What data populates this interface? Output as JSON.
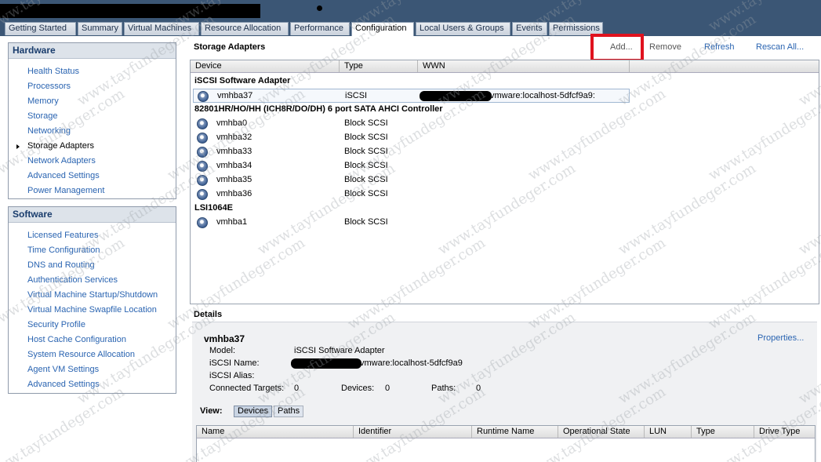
{
  "tabs": [
    {
      "label": "Getting Started"
    },
    {
      "label": "Summary"
    },
    {
      "label": "Virtual Machines"
    },
    {
      "label": "Resource Allocation"
    },
    {
      "label": "Performance"
    },
    {
      "label": "Configuration"
    },
    {
      "label": "Local Users & Groups"
    },
    {
      "label": "Events"
    },
    {
      "label": "Permissions"
    }
  ],
  "hardware": {
    "title": "Hardware",
    "items": [
      {
        "label": "Health Status"
      },
      {
        "label": "Processors"
      },
      {
        "label": "Memory"
      },
      {
        "label": "Storage"
      },
      {
        "label": "Networking"
      },
      {
        "label": "Storage Adapters"
      },
      {
        "label": "Network Adapters"
      },
      {
        "label": "Advanced Settings"
      },
      {
        "label": "Power Management"
      }
    ]
  },
  "software": {
    "title": "Software",
    "items": [
      {
        "label": "Licensed Features"
      },
      {
        "label": "Time Configuration"
      },
      {
        "label": "DNS and Routing"
      },
      {
        "label": "Authentication Services"
      },
      {
        "label": "Virtual Machine Startup/Shutdown"
      },
      {
        "label": "Virtual Machine Swapfile Location"
      },
      {
        "label": "Security Profile"
      },
      {
        "label": "Host Cache Configuration"
      },
      {
        "label": "System Resource Allocation"
      },
      {
        "label": "Agent VM Settings"
      },
      {
        "label": "Advanced Settings"
      }
    ]
  },
  "storage_adapters": {
    "title": "Storage Adapters",
    "actions": {
      "add": "Add...",
      "remove": "Remove",
      "refresh": "Refresh",
      "rescan": "Rescan All..."
    },
    "columns": {
      "device": "Device",
      "type": "Type",
      "wwn": "WWN"
    },
    "groups": [
      {
        "name": "iSCSI Software Adapter",
        "rows": [
          {
            "device": "vmhba37",
            "type": "iSCSI",
            "wwn": "vmware:localhost-5dfcf9a9:"
          }
        ]
      },
      {
        "name": "82801HR/HO/HH (ICH8R/DO/DH) 6 port SATA AHCI Controller",
        "rows": [
          {
            "device": "vmhba0",
            "type": "Block SCSI"
          },
          {
            "device": "vmhba32",
            "type": "Block SCSI"
          },
          {
            "device": "vmhba33",
            "type": "Block SCSI"
          },
          {
            "device": "vmhba34",
            "type": "Block SCSI"
          },
          {
            "device": "vmhba35",
            "type": "Block SCSI"
          },
          {
            "device": "vmhba36",
            "type": "Block SCSI"
          }
        ]
      },
      {
        "name": "LSI1064E",
        "rows": [
          {
            "device": "vmhba1",
            "type": "Block SCSI"
          }
        ]
      }
    ]
  },
  "details": {
    "title": "Details",
    "adapter": "vmhba37",
    "properties_link": "Properties...",
    "model_label": "Model:",
    "model_value": "iSCSI Software Adapter",
    "name_label": "iSCSI Name:",
    "name_value": "vmware:localhost-5dfcf9a9",
    "alias_label": "iSCSI Alias:",
    "targets_label": "Connected Targets:",
    "targets_value": "0",
    "devices_label": "Devices:",
    "devices_value": "0",
    "paths_label": "Paths:",
    "paths_value": "0",
    "view_label": "View:",
    "view_devices": "Devices",
    "view_paths": "Paths",
    "columns": [
      "Name",
      "Identifier",
      "Runtime Name",
      "Operational State",
      "LUN",
      "Type",
      "Drive Type"
    ]
  },
  "watermark_text": "www.tayfundeger.com"
}
